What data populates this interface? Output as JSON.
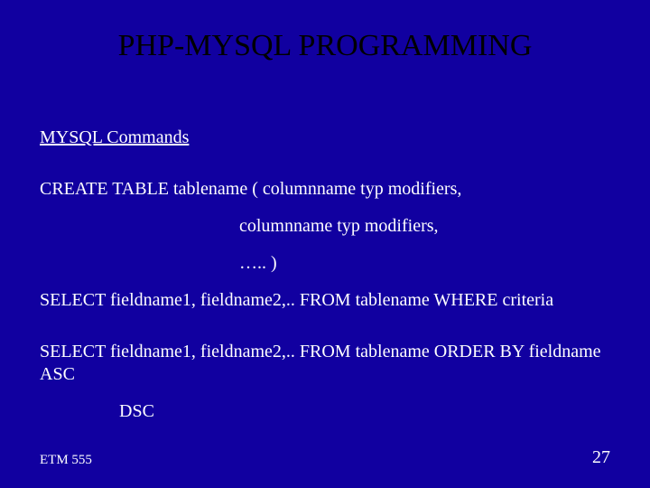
{
  "title": "PHP-MYSQL PROGRAMMING",
  "section_header": "MYSQL Commands",
  "create_line1": "CREATE TABLE tablename ( columnname typ modifiers,",
  "create_line2": "columnname typ modifiers,",
  "create_line3": "….. )",
  "select_where": "SELECT fieldname1, fieldname2,.. FROM tablename WHERE criteria",
  "select_order": "SELECT fieldname1, fieldname2,.. FROM tablename  ORDER BY fieldname ASC",
  "dsc": "DSC",
  "footer_left": "ETM 555",
  "footer_right": "27"
}
